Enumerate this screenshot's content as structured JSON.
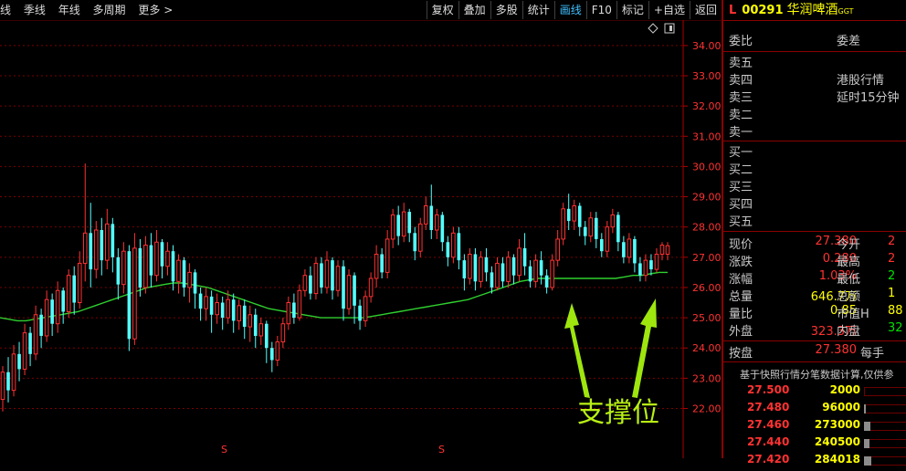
{
  "toolbar": {
    "period_items": [
      "线",
      "季线",
      "年线",
      "多周期",
      "更多 >"
    ],
    "buttons": [
      "复权",
      "叠加",
      "多股",
      "统计",
      "画线",
      "F10",
      "标记",
      "+自选",
      "返回"
    ],
    "active_button": "画线"
  },
  "stock": {
    "market_flag": "L",
    "code": "00291",
    "name": "华润啤酒",
    "tag": "GGT"
  },
  "order_book": {
    "wei_bi": "委比",
    "wei_cha": "委差",
    "sell_levels": [
      "卖五",
      "卖四",
      "卖三",
      "卖二",
      "卖一"
    ],
    "buy_levels": [
      "买一",
      "买二",
      "买三",
      "买四",
      "买五"
    ],
    "hk_note_line1": "港股行情",
    "hk_note_line2": "延时15分钟"
  },
  "quote": {
    "rows": [
      {
        "l1": "现价",
        "v1": "27.380",
        "l2": "今开",
        "v2": "2"
      },
      {
        "l1": "涨跌",
        "v1": "0.280",
        "l2": "最高",
        "v2": "2"
      },
      {
        "l1": "涨幅",
        "v1": "1.03%",
        "l2": "最低",
        "v2": "2"
      },
      {
        "l1": "总量",
        "v1": "646.7万",
        "l2": "总额",
        "v2": "1"
      },
      {
        "l1": "量比",
        "v1": "0.85",
        "l2": "市值H",
        "v2": "88"
      },
      {
        "l1": "外盘",
        "v1": "323.3万",
        "l2": "内盘",
        "v2": "32"
      }
    ],
    "an_pan_label": "按盘",
    "an_pan_value": "27.380",
    "mei_shou_label": "每手"
  },
  "tick_note": "基于快照行情分笔数据计算,仅供参",
  "ticks": [
    {
      "price": "27.500",
      "vol": "2000",
      "fill": 0.0
    },
    {
      "price": "27.480",
      "vol": "96000",
      "fill": 0.05
    },
    {
      "price": "27.460",
      "vol": "273000",
      "fill": 0.15
    },
    {
      "price": "27.440",
      "vol": "240500",
      "fill": 0.13
    },
    {
      "price": "27.420",
      "vol": "284018",
      "fill": 0.16
    }
  ],
  "chart_data": {
    "type": "candlestick",
    "y_ticks": [
      "34.00",
      "33.00",
      "32.00",
      "31.00",
      "30.00",
      "29.00",
      "28.00",
      "27.00",
      "26.00",
      "25.00",
      "24.00",
      "23.00",
      "22.00"
    ],
    "ylim": [
      21.2,
      34.6
    ],
    "annotation": "支撑位",
    "bottom_markers": [
      "S",
      "S"
    ],
    "candles": [
      [
        22.3,
        23.2,
        21.9,
        23.4
      ],
      [
        23.2,
        22.6,
        22.2,
        23.7
      ],
      [
        22.6,
        23.8,
        22.4,
        24.1
      ],
      [
        23.8,
        23.3,
        22.9,
        24.2
      ],
      [
        23.3,
        24.5,
        23.1,
        24.8
      ],
      [
        24.5,
        23.8,
        23.4,
        24.7
      ],
      [
        23.8,
        25.1,
        23.6,
        25.4
      ],
      [
        25.1,
        24.4,
        24.0,
        25.3
      ],
      [
        24.4,
        25.6,
        24.2,
        25.9
      ],
      [
        25.6,
        24.8,
        24.4,
        25.8
      ],
      [
        24.8,
        25.9,
        24.5,
        26.2
      ],
      [
        25.9,
        25.2,
        24.8,
        26.0
      ],
      [
        25.2,
        26.4,
        25.0,
        26.6
      ],
      [
        26.4,
        25.5,
        25.1,
        26.7
      ],
      [
        25.5,
        26.8,
        25.3,
        27.2
      ],
      [
        26.8,
        27.8,
        26.2,
        30.1
      ],
      [
        27.8,
        26.6,
        26.0,
        28.8
      ],
      [
        26.6,
        27.9,
        26.3,
        28.2
      ],
      [
        27.9,
        26.9,
        26.4,
        28.3
      ],
      [
        26.9,
        28.1,
        26.6,
        28.6
      ],
      [
        28.1,
        27.0,
        26.5,
        28.3
      ],
      [
        27.0,
        26.1,
        25.6,
        27.3
      ],
      [
        26.1,
        27.2,
        25.8,
        27.5
      ],
      [
        27.2,
        24.3,
        23.9,
        27.4
      ],
      [
        24.3,
        27.3,
        24.1,
        27.8
      ],
      [
        27.3,
        26.0,
        25.7,
        27.6
      ],
      [
        26.0,
        27.4,
        25.8,
        27.7
      ],
      [
        27.4,
        26.4,
        26.0,
        27.8
      ],
      [
        26.4,
        27.5,
        26.2,
        27.9
      ],
      [
        27.5,
        26.7,
        26.3,
        27.6
      ],
      [
        26.7,
        27.2,
        26.4,
        27.5
      ],
      [
        27.2,
        26.2,
        25.9,
        27.4
      ],
      [
        26.2,
        26.9,
        25.8,
        27.1
      ],
      [
        26.9,
        26.0,
        25.7,
        27.0
      ],
      [
        26.0,
        26.5,
        25.5,
        26.8
      ],
      [
        26.5,
        25.8,
        25.3,
        26.6
      ],
      [
        25.8,
        25.3,
        24.9,
        26.0
      ],
      [
        25.3,
        25.7,
        24.9,
        26.0
      ],
      [
        25.7,
        25.1,
        24.5,
        25.9
      ],
      [
        25.1,
        25.5,
        24.8,
        25.8
      ],
      [
        25.5,
        25.0,
        24.6,
        25.7
      ],
      [
        25.0,
        25.6,
        24.8,
        25.9
      ],
      [
        25.6,
        24.9,
        24.5,
        25.8
      ],
      [
        24.9,
        25.4,
        24.6,
        25.6
      ],
      [
        25.4,
        24.7,
        24.3,
        25.6
      ],
      [
        24.7,
        25.1,
        24.2,
        25.4
      ],
      [
        25.1,
        24.4,
        24.0,
        25.3
      ],
      [
        24.4,
        24.8,
        24.1,
        25.0
      ],
      [
        24.8,
        24.0,
        23.5,
        24.9
      ],
      [
        24.0,
        23.6,
        23.2,
        24.2
      ],
      [
        23.6,
        24.2,
        23.4,
        24.4
      ],
      [
        24.2,
        24.8,
        24.0,
        25.0
      ],
      [
        24.8,
        25.5,
        24.6,
        25.7
      ],
      [
        25.5,
        25.0,
        24.8,
        25.8
      ],
      [
        25.0,
        25.9,
        24.9,
        26.1
      ],
      [
        25.9,
        26.4,
        25.7,
        26.6
      ],
      [
        26.4,
        25.8,
        25.6,
        26.7
      ],
      [
        25.8,
        26.8,
        25.6,
        27.0
      ],
      [
        26.8,
        26.0,
        25.8,
        27.0
      ],
      [
        26.0,
        26.9,
        25.8,
        27.2
      ],
      [
        26.9,
        25.9,
        25.6,
        27.0
      ],
      [
        25.9,
        26.7,
        25.7,
        26.9
      ],
      [
        26.7,
        25.3,
        24.9,
        26.9
      ],
      [
        25.3,
        26.4,
        25.1,
        26.6
      ],
      [
        26.4,
        25.4,
        24.8,
        26.5
      ],
      [
        25.4,
        24.9,
        24.6,
        25.6
      ],
      [
        24.9,
        25.7,
        24.7,
        25.9
      ],
      [
        25.7,
        26.3,
        25.5,
        26.5
      ],
      [
        26.3,
        27.1,
        26.0,
        27.4
      ],
      [
        27.1,
        26.5,
        26.3,
        27.3
      ],
      [
        26.5,
        27.6,
        26.3,
        27.9
      ],
      [
        27.6,
        28.4,
        27.3,
        28.6
      ],
      [
        28.4,
        27.7,
        27.4,
        28.7
      ],
      [
        27.7,
        28.5,
        27.5,
        28.8
      ],
      [
        28.5,
        27.8,
        27.5,
        28.6
      ],
      [
        27.8,
        27.2,
        26.9,
        28.0
      ],
      [
        27.2,
        28.1,
        27.0,
        28.3
      ],
      [
        28.1,
        28.7,
        27.9,
        29.0
      ],
      [
        28.7,
        27.9,
        27.6,
        29.4
      ],
      [
        27.9,
        28.4,
        27.6,
        28.6
      ],
      [
        28.4,
        27.5,
        27.2,
        28.5
      ],
      [
        27.5,
        27.0,
        26.7,
        27.7
      ],
      [
        27.0,
        27.8,
        26.8,
        28.0
      ],
      [
        27.8,
        26.9,
        26.6,
        28.0
      ],
      [
        26.9,
        26.3,
        25.9,
        27.1
      ],
      [
        26.3,
        27.1,
        26.1,
        27.3
      ],
      [
        27.1,
        26.2,
        25.9,
        27.3
      ],
      [
        26.2,
        27.0,
        26.0,
        27.2
      ],
      [
        27.0,
        26.5,
        26.2,
        27.3
      ],
      [
        26.5,
        26.0,
        25.8,
        26.7
      ],
      [
        26.0,
        26.8,
        25.9,
        27.0
      ],
      [
        26.8,
        26.2,
        26.0,
        27.0
      ],
      [
        26.2,
        27.0,
        26.0,
        27.2
      ],
      [
        27.0,
        26.4,
        26.1,
        27.1
      ],
      [
        26.4,
        27.3,
        26.2,
        27.6
      ],
      [
        27.3,
        26.7,
        26.4,
        27.8
      ],
      [
        26.7,
        26.2,
        26.0,
        26.9
      ],
      [
        26.2,
        26.9,
        26.0,
        27.1
      ],
      [
        26.9,
        26.4,
        26.1,
        27.2
      ],
      [
        26.4,
        26.0,
        25.8,
        26.6
      ],
      [
        26.0,
        26.9,
        25.9,
        27.1
      ],
      [
        26.9,
        27.6,
        26.7,
        27.9
      ],
      [
        27.6,
        28.6,
        27.4,
        28.8
      ],
      [
        28.6,
        28.2,
        27.9,
        29.1
      ],
      [
        28.2,
        28.7,
        27.9,
        28.9
      ],
      [
        28.7,
        28.0,
        27.7,
        28.8
      ],
      [
        28.0,
        27.7,
        27.4,
        28.2
      ],
      [
        27.7,
        28.3,
        27.5,
        28.5
      ],
      [
        28.3,
        27.6,
        27.3,
        28.5
      ],
      [
        27.6,
        27.2,
        27.0,
        27.8
      ],
      [
        27.2,
        28.0,
        27.0,
        28.2
      ],
      [
        28.0,
        28.4,
        27.8,
        28.6
      ],
      [
        28.4,
        27.5,
        27.2,
        28.5
      ],
      [
        27.5,
        27.0,
        26.8,
        27.7
      ],
      [
        27.0,
        27.6,
        26.8,
        27.8
      ],
      [
        27.6,
        26.8,
        26.5,
        27.7
      ],
      [
        26.8,
        26.4,
        26.2,
        27.0
      ],
      [
        26.4,
        26.9,
        26.2,
        27.1
      ],
      [
        26.9,
        26.6,
        26.4,
        27.1
      ],
      [
        26.6,
        27.1,
        26.5,
        27.3
      ],
      [
        27.1,
        27.4,
        26.9,
        27.5
      ],
      [
        27.1,
        27.38,
        26.9,
        27.5
      ]
    ],
    "ma": [
      25.0,
      24.95,
      24.9,
      24.9,
      24.95,
      25.0,
      25.05,
      25.1,
      25.15,
      25.2,
      25.3,
      25.4,
      25.5,
      25.6,
      25.7,
      25.8,
      25.9,
      26.0,
      26.05,
      26.1,
      26.15,
      26.15,
      26.1,
      26.05,
      26.0,
      25.9,
      25.8,
      25.7,
      25.6,
      25.5,
      25.4,
      25.3,
      25.25,
      25.2,
      25.15,
      25.1,
      25.05,
      25.0,
      25.0,
      25.0,
      25.0,
      25.0,
      25.0,
      25.05,
      25.1,
      25.15,
      25.2,
      25.25,
      25.3,
      25.35,
      25.4,
      25.45,
      25.5,
      25.55,
      25.6,
      25.7,
      25.8,
      25.9,
      26.0,
      26.1,
      26.2,
      26.25,
      26.3,
      26.3,
      26.3,
      26.3,
      26.3,
      26.3,
      26.3,
      26.3,
      26.3,
      26.3,
      26.35,
      26.4,
      26.4,
      26.45,
      26.5,
      26.5
    ]
  }
}
